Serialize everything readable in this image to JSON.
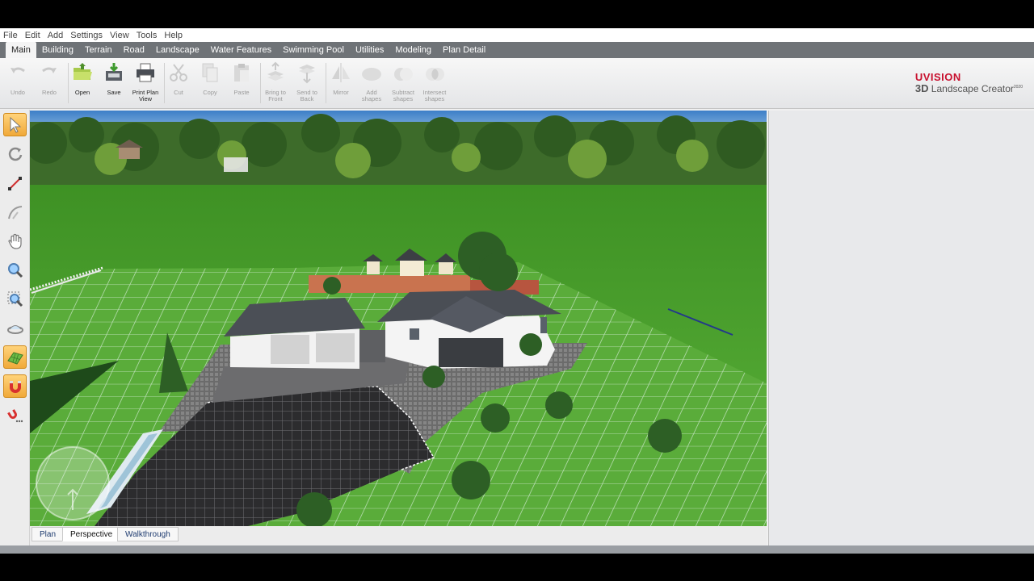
{
  "menu": [
    "File",
    "Edit",
    "Add",
    "Settings",
    "View",
    "Tools",
    "Help"
  ],
  "tabs": [
    {
      "label": "Main",
      "active": true
    },
    {
      "label": "Building",
      "active": false
    },
    {
      "label": "Terrain",
      "active": false
    },
    {
      "label": "Road",
      "active": false
    },
    {
      "label": "Landscape",
      "active": false
    },
    {
      "label": "Water Features",
      "active": false
    },
    {
      "label": "Swimming Pool",
      "active": false
    },
    {
      "label": "Utilities",
      "active": false
    },
    {
      "label": "Modeling",
      "active": false
    },
    {
      "label": "Plan Detail",
      "active": false
    }
  ],
  "toolbar": {
    "undo": "Undo",
    "redo": "Redo",
    "open": "Open",
    "save": "Save",
    "print": "Print Plan\nView",
    "cut": "Cut",
    "copy": "Copy",
    "paste": "Paste",
    "bring_front": "Bring to\nFront",
    "send_back": "Send to\nBack",
    "mirror": "Mirror",
    "add_shapes": "Add\nshapes",
    "subtract_shapes": "Subtract\nshapes",
    "intersect_shapes": "Intersect\nshapes"
  },
  "brand": {
    "company": "UVISION",
    "product_prefix": "3D",
    "product_name": " Landscape Creator",
    "year": "2020"
  },
  "view_tabs": [
    {
      "label": "Plan",
      "active": false
    },
    {
      "label": "Perspective",
      "active": true
    },
    {
      "label": "Walkthrough",
      "active": false
    }
  ],
  "colors": {
    "accent": "#f0a93a",
    "tab_bar": "#6f7377",
    "brand_red": "#c8102e",
    "grass": "#5fb33b"
  },
  "icons": [
    "select-arrow-icon",
    "rotate-icon",
    "draw-line-icon",
    "curve-icon",
    "hand-pan-icon",
    "zoom-icon",
    "zoom-area-icon",
    "orbit-icon",
    "grid-icon",
    "snap-magnet-icon",
    "snap-settings-icon"
  ]
}
